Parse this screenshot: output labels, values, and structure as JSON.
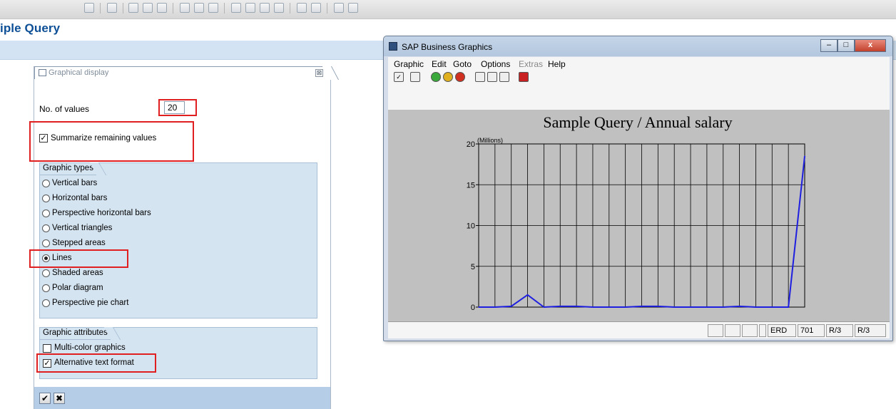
{
  "page": {
    "title": "iple Query"
  },
  "dialog": {
    "title": "Graphical display",
    "close_glyph": "⊠",
    "no_of_values_label": "No. of values",
    "no_of_values": "20",
    "summarize_label": "Summarize remaining values",
    "summarize_checked": true,
    "graphic_types": {
      "header": "Graphic types",
      "options": [
        {
          "label": "Vertical bars",
          "selected": false
        },
        {
          "label": "Horizontal bars",
          "selected": false
        },
        {
          "label": "Perspective horizontal bars",
          "selected": false
        },
        {
          "label": "Vertical triangles",
          "selected": false
        },
        {
          "label": "Stepped areas",
          "selected": false
        },
        {
          "label": "Lines",
          "selected": true
        },
        {
          "label": "Shaded areas",
          "selected": false
        },
        {
          "label": "Polar diagram",
          "selected": false
        },
        {
          "label": "Perspective pie chart",
          "selected": false
        }
      ]
    },
    "graphic_attributes": {
      "header": "Graphic attributes",
      "multicolor_label": "Multi-color graphics",
      "multicolor_checked": false,
      "alt_text_label": "Alternative text format",
      "alt_text_checked": true
    },
    "ok_glyph": "✔",
    "cancel_glyph": "✖"
  },
  "graphics_window": {
    "title": "SAP Business Graphics",
    "menu": [
      "Graphic",
      "Edit",
      "Goto",
      "Options",
      "Extras",
      "Help"
    ],
    "disabled_menu": [
      "Extras"
    ],
    "status": {
      "field1": "ERD",
      "field2": "701",
      "field3": "R/3",
      "field4": "R/3"
    }
  },
  "colors": {
    "highlight_red": "#e02020",
    "line_blue": "#1f1fe0",
    "sap_blue_title": "#0d4f96"
  },
  "chart_data": {
    "type": "line",
    "title": "Sample Query / Annual salary",
    "unit_label": "(Millions)",
    "ylim": [
      0,
      20
    ],
    "yticks": [
      0,
      5,
      10,
      15,
      20
    ],
    "x": [
      1,
      2,
      3,
      4,
      5,
      6,
      7,
      8,
      9,
      10,
      11,
      12,
      13,
      14,
      15,
      16,
      17,
      18,
      19,
      20,
      21
    ],
    "values": [
      0,
      0,
      0.1,
      1.5,
      0,
      0.1,
      0.1,
      0,
      0,
      0,
      0.1,
      0.1,
      0,
      0,
      0,
      0,
      0.1,
      0,
      0,
      0,
      18.5
    ],
    "grid": true
  }
}
